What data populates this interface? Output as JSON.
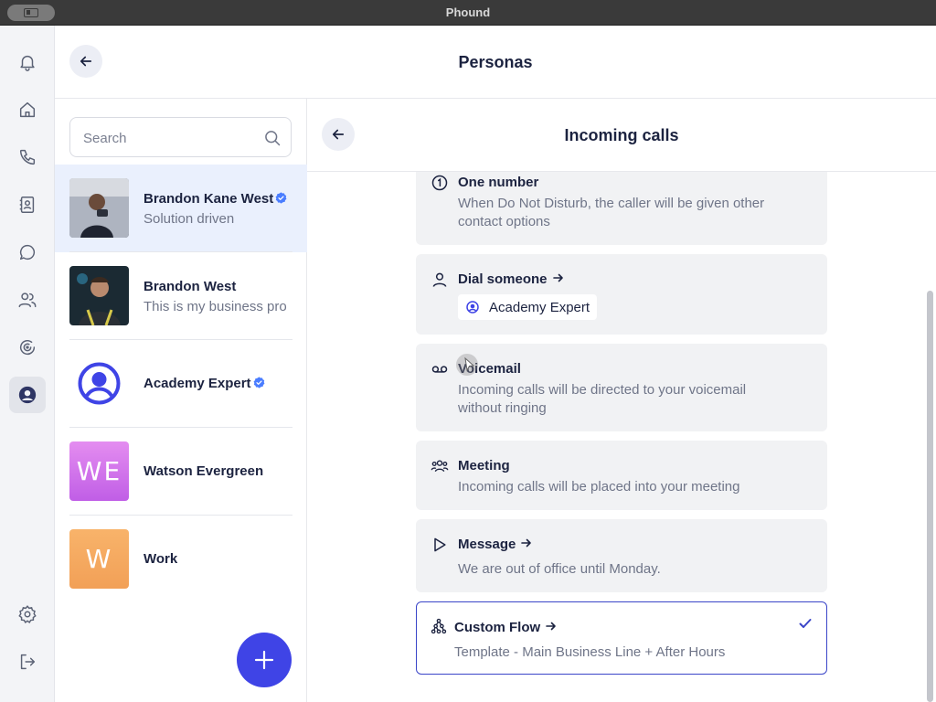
{
  "window": {
    "title": "Phound"
  },
  "rail": {
    "items": [
      {
        "name": "notifications",
        "icon": "bell-icon"
      },
      {
        "name": "home",
        "icon": "home-icon"
      },
      {
        "name": "calls",
        "icon": "phone-icon"
      },
      {
        "name": "contacts",
        "icon": "address-book-icon"
      },
      {
        "name": "messages",
        "icon": "chat-icon"
      },
      {
        "name": "team",
        "icon": "users-icon"
      },
      {
        "name": "activity",
        "icon": "spiral-icon"
      },
      {
        "name": "personas",
        "icon": "persona-icon",
        "active": true
      },
      {
        "name": "settings",
        "icon": "gear-icon"
      },
      {
        "name": "logout",
        "icon": "logout-icon"
      }
    ]
  },
  "header": {
    "title": "Personas"
  },
  "search": {
    "placeholder": "Search"
  },
  "personas": [
    {
      "name": "Brandon Kane West",
      "subtitle": "Solution driven",
      "verified": true,
      "selected": true
    },
    {
      "name": "Brandon West",
      "subtitle": "This is my business pro",
      "verified": false
    },
    {
      "name": "Academy Expert",
      "subtitle": "",
      "verified": true
    },
    {
      "name": "Watson Evergreen",
      "subtitle": "",
      "initials": "WE",
      "verified": false
    },
    {
      "name": "Work",
      "subtitle": "",
      "initials": "W",
      "verified": false
    }
  ],
  "detail": {
    "title": "Incoming calls",
    "options": [
      {
        "id": "one-number",
        "icon": "circle-one-icon",
        "title": "One number",
        "description": "When Do Not Disturb, the caller will be given other contact options"
      },
      {
        "id": "dial-someone",
        "icon": "person-icon",
        "title": "Dial someone",
        "arrow": true,
        "chip": "Academy Expert"
      },
      {
        "id": "voicemail",
        "icon": "voicemail-icon",
        "title": "Voicemail",
        "description": "Incoming calls will be directed to your voicemail without ringing"
      },
      {
        "id": "meeting",
        "icon": "group-icon",
        "title": "Meeting",
        "description": "Incoming calls will be placed into your meeting"
      },
      {
        "id": "message",
        "icon": "play-icon",
        "title": "Message",
        "arrow": true,
        "description": "We are out of office until Monday."
      },
      {
        "id": "custom-flow",
        "icon": "flow-icon",
        "title": "Custom Flow",
        "arrow": true,
        "description": "Template - Main Business Line + After Hours",
        "selected": true
      }
    ]
  },
  "colors": {
    "accent": "#3f44e6",
    "selected_row": "#eaf0fd",
    "card": "#f1f2f4",
    "selected_border": "#3a45c8",
    "verified": "#4a7dff"
  }
}
